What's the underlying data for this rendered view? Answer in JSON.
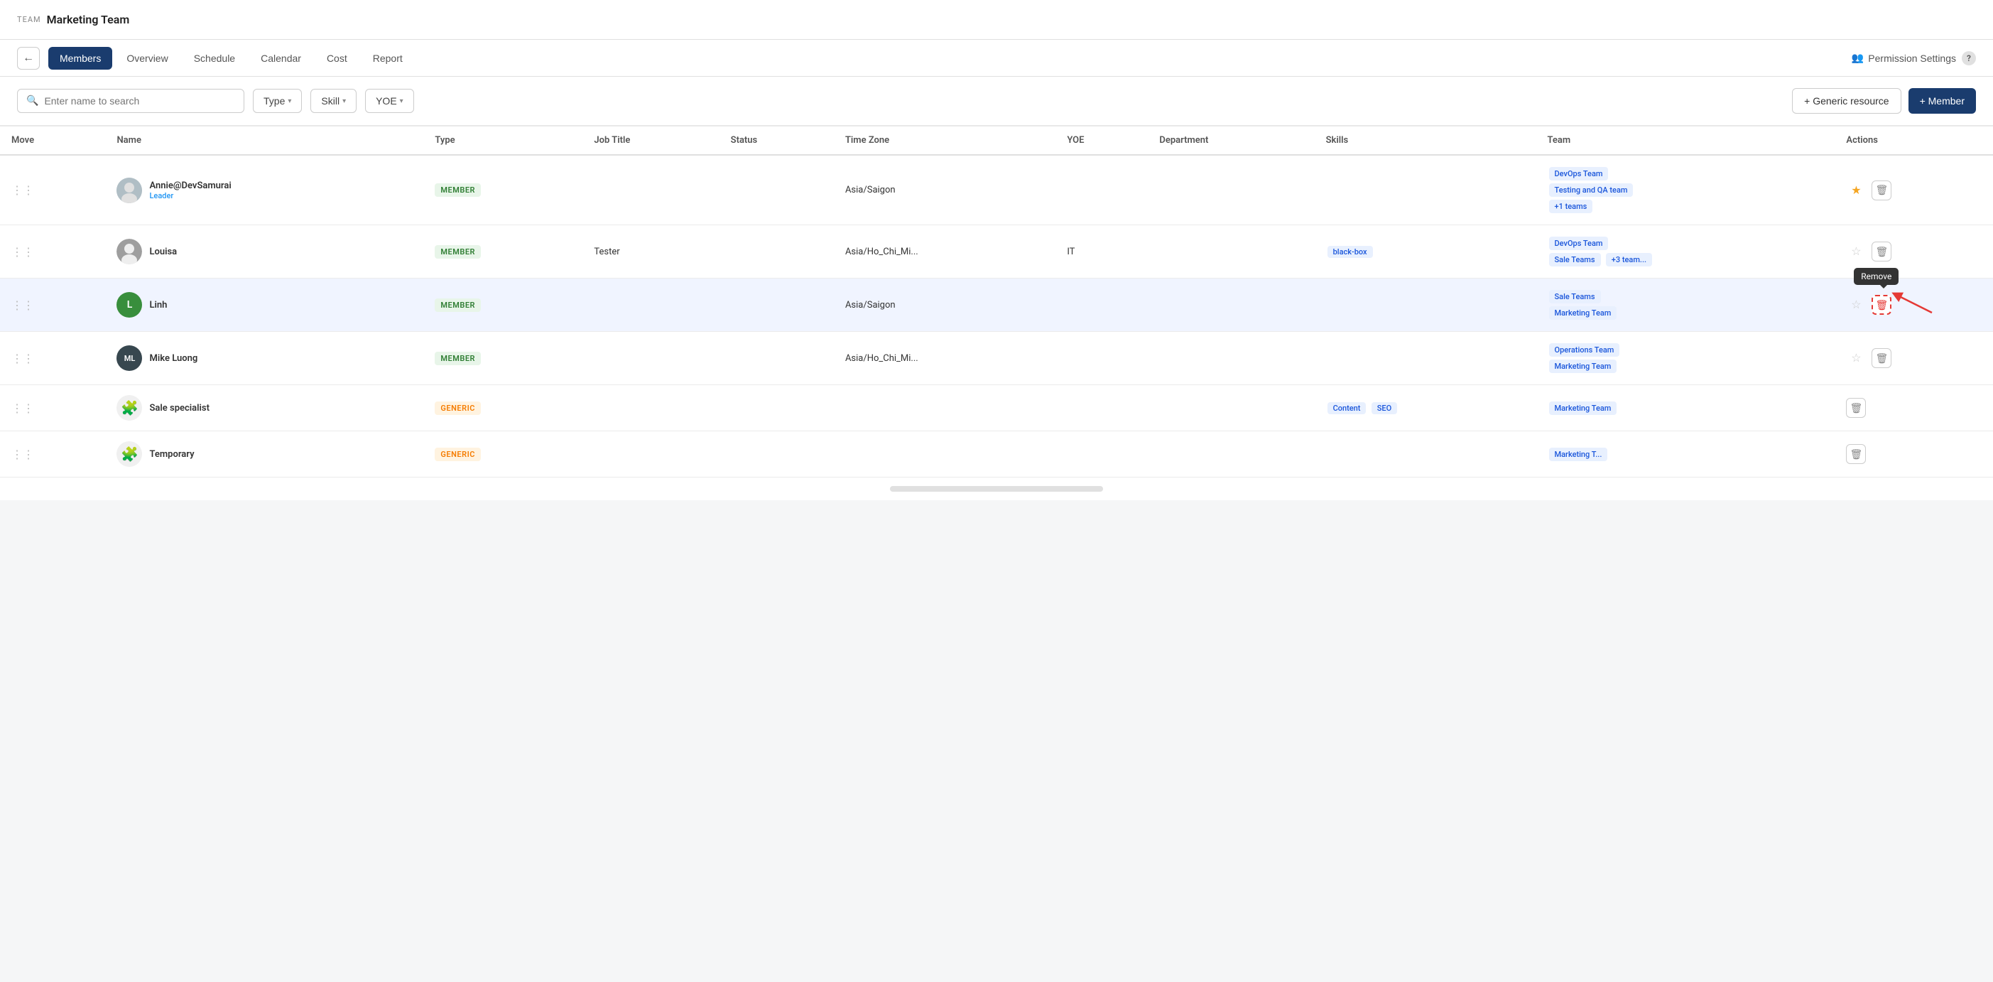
{
  "topNav": {
    "teamLabel": "TEAM",
    "teamTitle": "Marketing Team"
  },
  "tabs": {
    "back": "←",
    "items": [
      {
        "label": "Members",
        "active": true
      },
      {
        "label": "Overview",
        "active": false
      },
      {
        "label": "Schedule",
        "active": false
      },
      {
        "label": "Calendar",
        "active": false
      },
      {
        "label": "Cost",
        "active": false
      },
      {
        "label": "Report",
        "active": false
      }
    ],
    "permissionSettings": "Permission Settings",
    "helpLabel": "?"
  },
  "toolbar": {
    "searchPlaceholder": "Enter name to search",
    "filters": [
      {
        "label": "Type"
      },
      {
        "label": "Skill"
      },
      {
        "label": "YOE"
      }
    ],
    "genericResourceBtn": "+ Generic resource",
    "memberBtn": "+ Member"
  },
  "table": {
    "columns": [
      "Move",
      "Name",
      "Type",
      "Job Title",
      "Status",
      "Time Zone",
      "YOE",
      "Department",
      "Skills",
      "Team",
      "Actions"
    ],
    "rows": [
      {
        "id": 1,
        "name": "Annie@DevSamurai",
        "role": "Leader",
        "avatarType": "img",
        "avatarColor": "",
        "avatarInitials": "",
        "type": "MEMBER",
        "jobTitle": "",
        "status": "",
        "timezone": "Asia/Saigon",
        "yoe": "",
        "department": "",
        "skills": [],
        "teams": [
          "DevOps Team",
          "Testing and QA team",
          "+1 teams"
        ],
        "starred": true,
        "highlighted": false
      },
      {
        "id": 2,
        "name": "Louisa",
        "role": "",
        "avatarType": "img",
        "avatarColor": "",
        "avatarInitials": "",
        "type": "MEMBER",
        "jobTitle": "Tester",
        "status": "",
        "timezone": "Asia/Ho_Chi_Mi...",
        "yoe": "IT",
        "department": "",
        "skills": [
          "black-box"
        ],
        "teams": [
          "DevOps Team",
          "Sale Teams",
          "+3 team..."
        ],
        "starred": false,
        "highlighted": false
      },
      {
        "id": 3,
        "name": "Linh",
        "role": "",
        "avatarType": "initial",
        "avatarColor": "avatar-green",
        "avatarInitials": "L",
        "type": "MEMBER",
        "jobTitle": "",
        "status": "",
        "timezone": "Asia/Saigon",
        "yoe": "",
        "department": "",
        "skills": [],
        "teams": [
          "Sale Teams",
          "Marketing Team"
        ],
        "starred": false,
        "highlighted": true,
        "showTooltip": true,
        "tooltipText": "Remove"
      },
      {
        "id": 4,
        "name": "Mike Luong",
        "role": "",
        "avatarType": "initials",
        "avatarColor": "avatar-dark",
        "avatarInitials": "ML",
        "type": "MEMBER",
        "jobTitle": "",
        "status": "",
        "timezone": "Asia/Ho_Chi_Mi...",
        "yoe": "",
        "department": "",
        "skills": [],
        "teams": [
          "Operations Team",
          "Marketing Team"
        ],
        "starred": false,
        "highlighted": false
      },
      {
        "id": 5,
        "name": "Sale specialist",
        "role": "",
        "avatarType": "puzzle",
        "avatarColor": "",
        "avatarInitials": "",
        "type": "GENERIC",
        "jobTitle": "",
        "status": "",
        "timezone": "",
        "yoe": "",
        "department": "",
        "skills": [
          "Content",
          "SEO"
        ],
        "teams": [
          "Marketing Team"
        ],
        "starred": false,
        "highlighted": false
      },
      {
        "id": 6,
        "name": "Temporary",
        "role": "",
        "avatarType": "puzzle",
        "avatarColor": "",
        "avatarInitials": "",
        "type": "GENERIC",
        "jobTitle": "",
        "status": "",
        "timezone": "",
        "yoe": "",
        "department": "",
        "skills": [],
        "teams": [
          "Marketing T..."
        ],
        "starred": false,
        "highlighted": false
      }
    ]
  },
  "icons": {
    "search": "🔍",
    "drag": "⋮⋮",
    "star": "★",
    "starEmpty": "☆",
    "trash": "🗑",
    "chevronDown": "▾",
    "back": "←",
    "peopleGroup": "👥",
    "puzzle": "🧩"
  }
}
